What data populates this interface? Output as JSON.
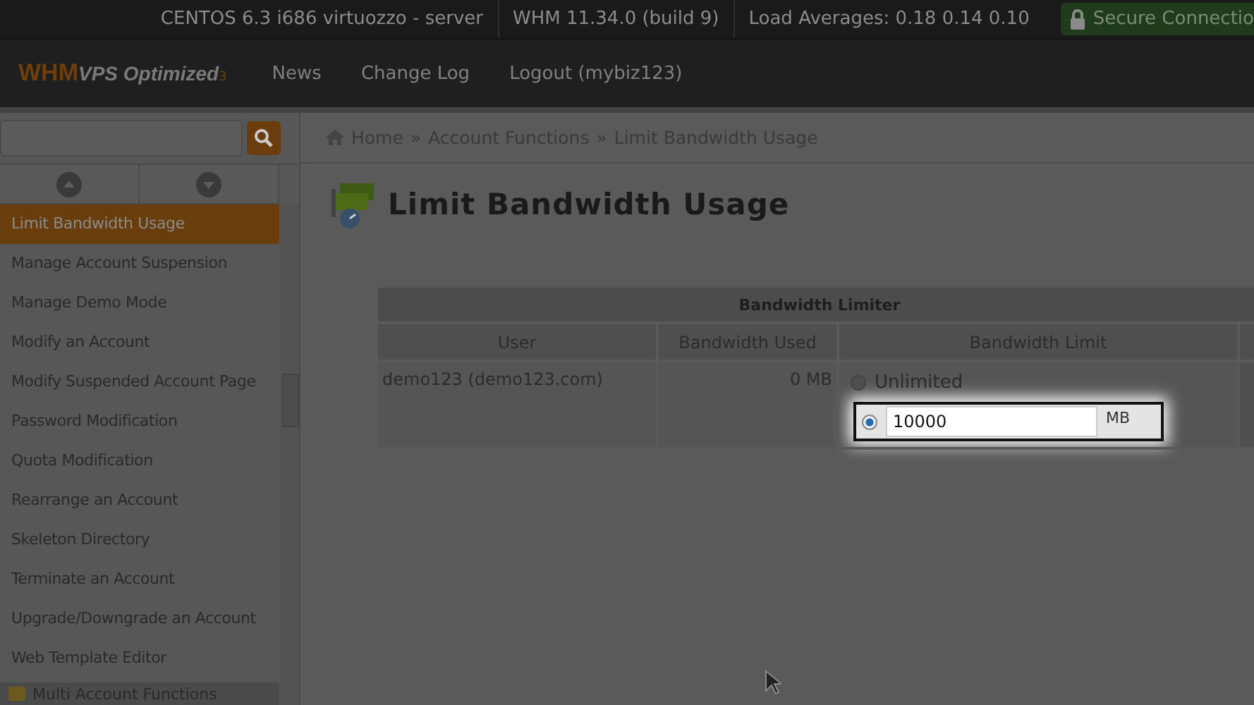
{
  "top_bar": {
    "items": [
      "CENTOS 6.3 i686 virtuozzo - server",
      "WHM 11.34.0 (build 9)",
      "Load Averages: 0.18 0.14 0.10"
    ],
    "secure": "Secure Connectio"
  },
  "nav": {
    "logo_main": "WHM",
    "logo_sub": "VPS Optimized",
    "logo_version": "3",
    "links": [
      "News",
      "Change Log",
      "Logout (mybiz123)"
    ]
  },
  "breadcrumb": [
    "Home",
    "Account Functions",
    "Limit Bandwidth Usage"
  ],
  "breadcrumb_separator": "»",
  "sidebar": {
    "items": [
      {
        "label": "Limit Bandwidth Usage",
        "selected": true
      },
      {
        "label": "Manage Account Suspension",
        "selected": false
      },
      {
        "label": "Manage Demo Mode",
        "selected": false
      },
      {
        "label": "Modify an Account",
        "selected": false
      },
      {
        "label": "Modify Suspended Account Page",
        "selected": false
      },
      {
        "label": "Password Modification",
        "selected": false
      },
      {
        "label": "Quota Modification",
        "selected": false
      },
      {
        "label": "Rearrange an Account",
        "selected": false
      },
      {
        "label": "Skeleton Directory",
        "selected": false
      },
      {
        "label": "Terminate an Account",
        "selected": false
      },
      {
        "label": "Upgrade/Downgrade an Account",
        "selected": false
      },
      {
        "label": "Web Template Editor",
        "selected": false
      }
    ],
    "next_group": "Multi Account Functions"
  },
  "page_title": "Limit Bandwidth Usage",
  "table": {
    "caption": "Bandwidth Limiter",
    "columns": [
      "User",
      "Bandwidth Used",
      "Bandwidth Limit"
    ],
    "rows": [
      {
        "user": "demo123 (demo123.com)",
        "used": "0 MB",
        "options": [
          {
            "kind": "label",
            "label": "Unlimited",
            "selected": false
          },
          {
            "kind": "input",
            "value": "10000",
            "unit": "MB",
            "selected": true
          }
        ]
      }
    ]
  }
}
